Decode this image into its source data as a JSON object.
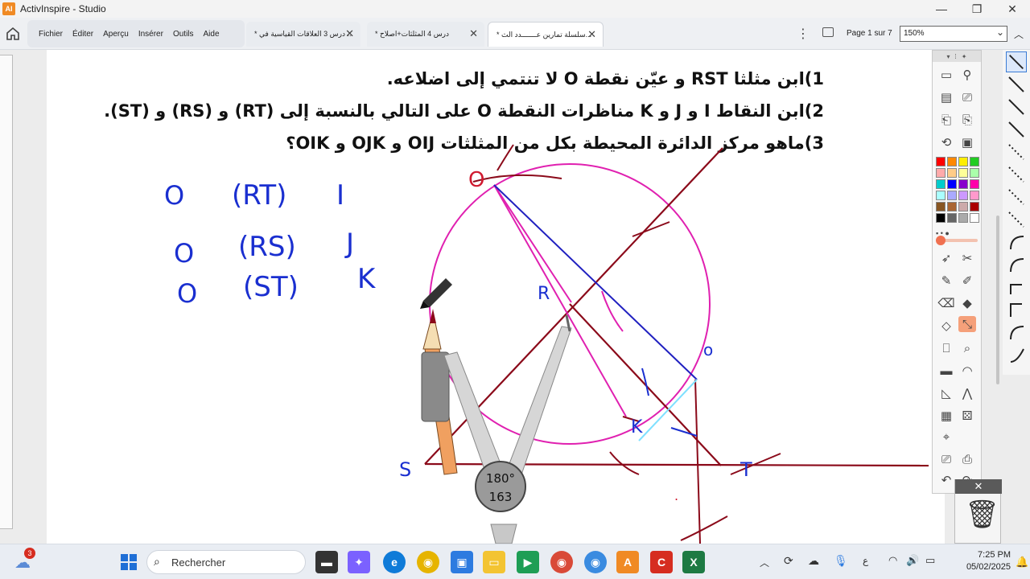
{
  "window": {
    "title": "ActivInspire - Studio",
    "app_icon_text": "AI",
    "controls": {
      "minimize": "—",
      "maximize": "❐",
      "close": "✕"
    }
  },
  "menu": {
    "items": [
      "Fichier",
      "Éditer",
      "Aperçu",
      "Insérer",
      "Outils",
      "Aide"
    ]
  },
  "tabs": [
    {
      "label": "* درس 3 العلاقات القياسية في ...",
      "close": "✕"
    },
    {
      "label": "* درس 4 المثلثات+اصلاح",
      "close": "✕"
    },
    {
      "label": "* سلسلة تمارين عـــــــدد الث...",
      "close": "✕"
    }
  ],
  "page_indicator": "Page 1 sur 7",
  "zoom": {
    "value": "150%"
  },
  "content": {
    "questions": [
      "1)ابن مثلثا RST و عيّن نقطة O لا تنتمي إلى اضلاعه.",
      "2)ابن النقاط I و J و K مناظرات النقطة O على التالي بالنسبة إلى (RT) و (RS) و (ST).",
      "3)ماهو مركز الدائرة المحيطة بكل من المثلثات OIJ و OJK و OIK؟"
    ],
    "handwriting": {
      "table": [
        {
          "point": "O",
          "line": "(RT)",
          "image": "I"
        },
        {
          "point": "O",
          "line": "(RS)",
          "image": "J"
        },
        {
          "point": "O",
          "line": "(ST)",
          "image": "K"
        }
      ],
      "figure_labels": {
        "O": "O",
        "R": "R",
        "S": "S",
        "T": "T",
        "o_small": "o",
        "K": "K"
      }
    },
    "compass": {
      "angle": "180°",
      "radius": "163"
    },
    "colors": {
      "circle": "#e020b0",
      "lines": "#8b0a1a",
      "ink": "#1a2fd0",
      "segment_blue": "#2020c0"
    }
  },
  "toolbox": {
    "palette": [
      "#ff0000",
      "#ff8800",
      "#ffee00",
      "#22cc22",
      "#ffaaaa",
      "#ffcc88",
      "#ffff99",
      "#aaffaa",
      "#00cccc",
      "#0000ff",
      "#8800cc",
      "#ff00aa",
      "#aaffff",
      "#aaaaff",
      "#cc99ff",
      "#ff99cc",
      "#885522",
      "#aa6633",
      "#ccaaaa",
      "#aa0000",
      "#000000",
      "#666666",
      "#aaaaaa",
      "#ffffff"
    ]
  },
  "taskbar": {
    "search_placeholder": "Rechercher",
    "weather_badge": "3",
    "time": "7:25 PM",
    "date": "05/02/2025",
    "lang": "ع"
  }
}
